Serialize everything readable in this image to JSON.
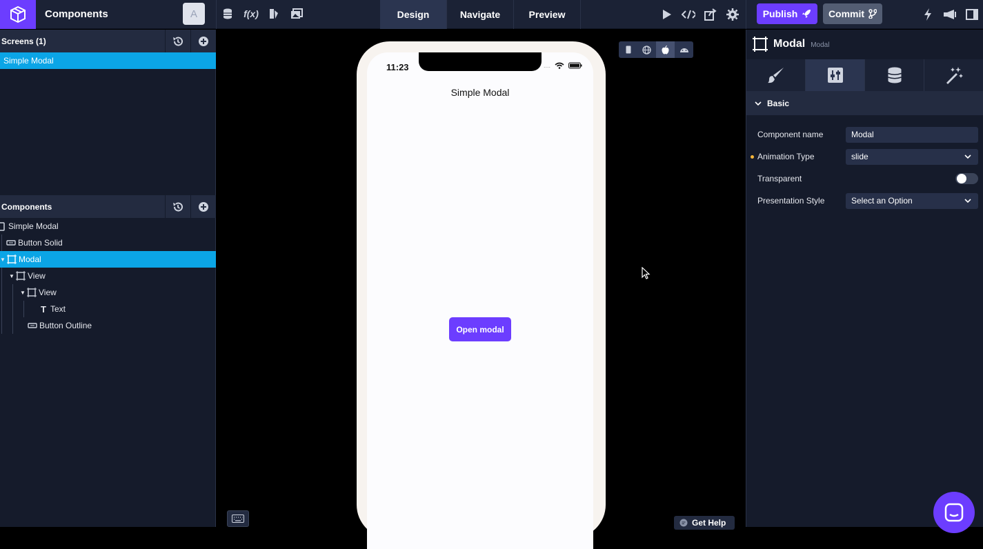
{
  "app": {
    "title": "Components",
    "avatar_initial": "A"
  },
  "modes": [
    "Design",
    "Navigate",
    "Preview"
  ],
  "actions": {
    "publish": "Publish",
    "commit": "Commit"
  },
  "left": {
    "screens_header": "Screens (1)",
    "screens": [
      "Simple Modal"
    ],
    "components_header": "Components",
    "tree": [
      {
        "label": "Simple Modal",
        "icon": "screen-icon",
        "depth": 0,
        "selected": false
      },
      {
        "label": "Button Solid",
        "icon": "button-icon",
        "depth": 1,
        "selected": false
      },
      {
        "label": "Modal",
        "icon": "frame-icon",
        "depth": 1,
        "selected": true
      },
      {
        "label": "View",
        "icon": "frame-icon",
        "depth": 2,
        "selected": false
      },
      {
        "label": "View",
        "icon": "frame-icon",
        "depth": 3,
        "selected": false
      },
      {
        "label": "Text",
        "icon": "text-icon",
        "depth": 4,
        "selected": false
      },
      {
        "label": "Button Outline",
        "icon": "button-icon",
        "depth": 3,
        "selected": false
      }
    ]
  },
  "phone": {
    "time": "11:23",
    "title": "Simple Modal",
    "button": "Open modal"
  },
  "canvas": {
    "get_help": "Get Help"
  },
  "right": {
    "title": "Modal",
    "subtitle": "Modal",
    "section": "Basic",
    "props": {
      "component_name_label": "Component name",
      "component_name_value": "Modal",
      "animation_type_label": "Animation Type",
      "animation_type_value": "slide",
      "transparent_label": "Transparent",
      "transparent_value": false,
      "presentation_style_label": "Presentation Style",
      "presentation_style_value": "Select an Option"
    }
  },
  "colors": {
    "accent": "#6c3dff",
    "selection": "#0ba5e6",
    "panel": "#151b2b"
  }
}
